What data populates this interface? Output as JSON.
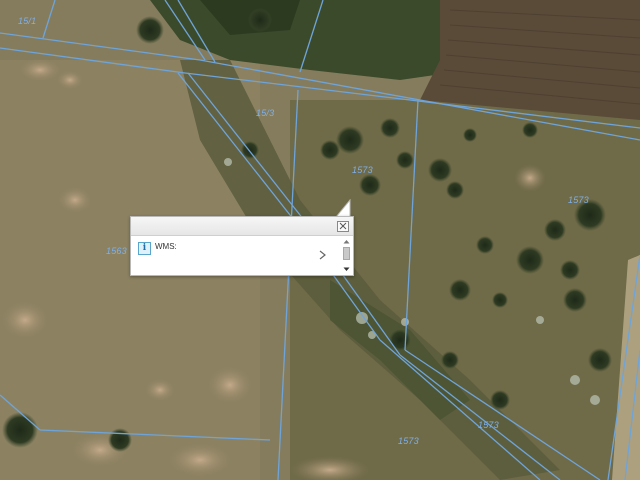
{
  "map": {
    "parcel_labels": [
      "15/3",
      "1573",
      "1573",
      "1563",
      "15/1",
      "1573",
      "1573"
    ],
    "boundary_color": "#6fa4d9"
  },
  "popup": {
    "layer_name": "WMS:",
    "info_icon": "info-icon",
    "close_icon": "close-icon",
    "next_icon": "chevron-right-icon",
    "scroll_up_icon": "scroll-up-arrow-icon",
    "scroll_down_icon": "scroll-down-arrow-icon"
  }
}
